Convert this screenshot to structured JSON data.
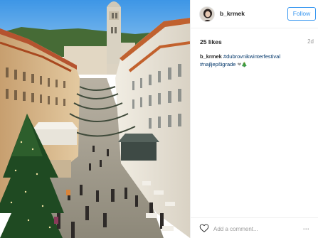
{
  "post": {
    "photo_icon": "photo-stradun-christmas",
    "header": {
      "username": "b_krmek",
      "follow_label": "Follow",
      "avatar_icon": "avatar-icon"
    },
    "likes": "25 likes",
    "date": "2d",
    "caption": {
      "username": "b_krmek",
      "hashtag_1": "#dubrovnikwinterfestival",
      "hashtag_2": "#najljepšigrade",
      "emoji": "❤🎄"
    },
    "comment_placeholder": "Add a comment...",
    "more_label": "...",
    "heart_icon": "heart-icon"
  },
  "colors": {
    "follow_blue": "#3897f0",
    "hashtag_navy": "#003569",
    "muted_grey": "#999999"
  }
}
